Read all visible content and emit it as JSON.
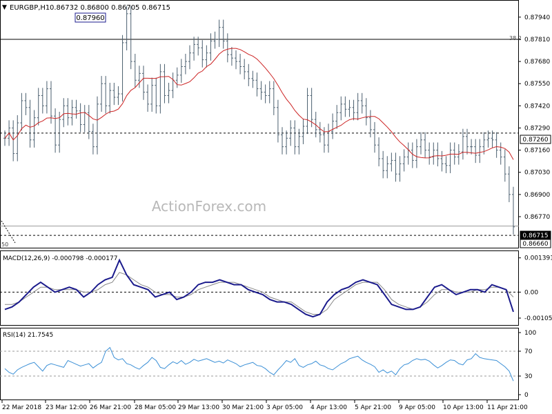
{
  "header": {
    "symbol": "EURGBP,H1",
    "ohlc": "0.86732 0.86800 0.86705 0.86715"
  },
  "watermark": "ActionForex.com",
  "colors": {
    "price": "#4a5e6e",
    "ma": "#cc2222",
    "macd": "#1a1a8c",
    "signal": "#888888",
    "rsi": "#3a8fd6",
    "grid": "#000000",
    "axis_text": "#000000"
  },
  "chart_data": [
    {
      "type": "line",
      "name": "price",
      "title": "EURGBP,H1",
      "series": [
        {
          "name": "",
          "values": [
            0.8723,
            0.8729,
            0.8714,
            0.8732,
            0.8745,
            0.8741,
            0.8722,
            0.8735,
            0.8748,
            0.8742,
            0.8752,
            0.8736,
            0.8719,
            0.8734,
            0.8742,
            0.8735,
            0.8741,
            0.8739,
            0.8731,
            0.8738,
            0.8727,
            0.8718,
            0.8743,
            0.8755,
            0.8742,
            0.8751,
            0.8747,
            0.8749,
            0.8779,
            0.8796,
            0.8768,
            0.8757,
            0.8761,
            0.875,
            0.8743,
            0.8754,
            0.8742,
            0.8762,
            0.8748,
            0.8751,
            0.8757,
            0.876,
            0.8765,
            0.8768,
            0.8773,
            0.8778,
            0.8776,
            0.8769,
            0.8773,
            0.878,
            0.8781,
            0.8788,
            0.878,
            0.8772,
            0.877,
            0.8768,
            0.8765,
            0.8762,
            0.8758,
            0.8757,
            0.8752,
            0.875,
            0.8748,
            0.8752,
            0.8741,
            0.8725,
            0.8718,
            0.8723,
            0.8729,
            0.8718,
            0.8724,
            0.873,
            0.8748,
            0.8734,
            0.8728,
            0.8725,
            0.8719,
            0.8727,
            0.8733,
            0.8738,
            0.8743,
            0.874,
            0.8741,
            0.8738,
            0.8745,
            0.8742,
            0.8735,
            0.8728,
            0.8719,
            0.8711,
            0.8704,
            0.8708,
            0.871,
            0.8702,
            0.8708,
            0.8712,
            0.8716,
            0.871,
            0.8718,
            0.8722,
            0.8716,
            0.8712,
            0.8716,
            0.8711,
            0.8708,
            0.8707,
            0.8716,
            0.8712,
            0.8715,
            0.8724,
            0.8718,
            0.8718,
            0.8713,
            0.8718,
            0.8722,
            0.8723,
            0.8722,
            0.8716,
            0.8712,
            0.8702,
            0.869,
            0.8671
          ]
        }
      ],
      "ylim": [
        0.866,
        0.88
      ],
      "y_ticks": [
        "0.87940",
        "0.87810",
        "0.87680",
        "0.87550",
        "0.87420",
        "0.87290",
        "0.87160",
        "0.87030",
        "0.86900",
        "0.86770"
      ],
      "x_ticks": [
        "22 Mar 2018",
        "23 Mar 12:00",
        "26 Mar 21:00",
        "28 Mar 05:00",
        "29 Mar 13:00",
        "30 Mar 21:00",
        "3 Apr 05:00",
        "4 Apr 13:00",
        "5 Apr 21:00",
        "9 Apr 05:00",
        "10 Apr 13:00",
        "11 Apr 21:00"
      ],
      "annotations": {
        "high_label": "0.87960",
        "fib_label": "38.2",
        "fib_level": 0.8781,
        "fib_low_label": "50",
        "support_level": 0.8726,
        "support_label": "0.87260",
        "last_label": "0.86715",
        "low_label": "0.86660"
      }
    },
    {
      "type": "line",
      "name": "macd",
      "title": "MACD(12,26,9) -0.000798 -0.000177",
      "ylim": [
        -0.00125,
        0.00155
      ],
      "y_ticks": [
        "0.001391",
        "0.00",
        "-0.001054"
      ],
      "series": [
        {
          "name": "",
          "values": [
            -0.0007,
            -0.0006,
            -0.0004,
            -0.0001,
            0.0002,
            0.0004,
            0.0002,
            0.0,
            0.0001,
            0.0002,
            0.0001,
            -0.0002,
            0.0,
            0.0003,
            0.0005,
            0.0006,
            0.0013,
            0.0007,
            0.0003,
            0.0002,
            0.0001,
            -0.0002,
            -0.0001,
            0.0,
            -0.0003,
            -0.0002,
            0.0,
            0.0003,
            0.0004,
            0.0004,
            0.0005,
            0.0004,
            0.0003,
            0.0003,
            0.0001,
            0.0,
            -0.0001,
            -0.0003,
            -0.0004,
            -0.0004,
            -0.0005,
            -0.0007,
            -0.0009,
            -0.001,
            -0.0009,
            -0.0004,
            -0.0001,
            0.0001,
            0.0002,
            0.0004,
            0.0005,
            0.0004,
            0.0003,
            -0.0001,
            -0.0005,
            -0.0006,
            -0.0007,
            -0.0007,
            -0.0006,
            -0.0002,
            0.0002,
            0.0003,
            0.0001,
            -0.0001,
            0.0,
            0.0001,
            0.0001,
            0.0,
            0.0003,
            0.0002,
            0.0001,
            -0.0008
          ]
        },
        {
          "name": "",
          "values": [
            -0.0005,
            -0.0005,
            -0.0004,
            -0.0002,
            0.0,
            0.0002,
            0.0002,
            0.0001,
            0.0001,
            0.0001,
            0.0001,
            0.0,
            0.0,
            0.0001,
            0.0003,
            0.0004,
            0.0008,
            0.0007,
            0.0005,
            0.0003,
            0.0002,
            0.0,
            -0.0001,
            -0.0001,
            -0.0002,
            -0.0002,
            -0.0001,
            0.0001,
            0.0002,
            0.0003,
            0.0004,
            0.0004,
            0.0004,
            0.0003,
            0.0002,
            0.0001,
            0.0,
            -0.0002,
            -0.0003,
            -0.0004,
            -0.0004,
            -0.0006,
            -0.0008,
            -0.0009,
            -0.0009,
            -0.0007,
            -0.0003,
            -0.0001,
            0.0001,
            0.0003,
            0.0004,
            0.0004,
            0.0004,
            0.0001,
            -0.0003,
            -0.0005,
            -0.0006,
            -0.0007,
            -0.0006,
            -0.0004,
            -0.0001,
            0.0001,
            0.0001,
            0.0,
            0.0,
            0.0,
            0.0001,
            0.0001,
            0.0002,
            0.0002,
            0.0001,
            -0.0002
          ]
        }
      ]
    },
    {
      "type": "line",
      "name": "rsi",
      "title": "RSI(14) 21.7545",
      "ylim": [
        0,
        100
      ],
      "y_ticks": [
        "100",
        "70",
        "30",
        "0"
      ],
      "levels": [
        70,
        30
      ],
      "series": [
        {
          "name": "",
          "values": [
            42,
            36,
            33,
            40,
            44,
            47,
            50,
            52,
            45,
            38,
            47,
            50,
            48,
            46,
            44,
            55,
            52,
            49,
            46,
            48,
            50,
            43,
            48,
            52,
            70,
            76,
            60,
            56,
            58,
            50,
            48,
            44,
            41,
            47,
            52,
            60,
            55,
            44,
            42,
            48,
            53,
            50,
            55,
            49,
            52,
            57,
            54,
            56,
            58,
            55,
            52,
            54,
            51,
            56,
            53,
            50,
            45,
            48,
            50,
            52,
            47,
            46,
            42,
            36,
            32,
            40,
            47,
            55,
            52,
            58,
            47,
            44,
            48,
            50,
            54,
            48,
            46,
            42,
            40,
            45,
            50,
            53,
            58,
            60,
            62,
            56,
            52,
            49,
            45,
            36,
            40,
            35,
            38,
            32,
            42,
            48,
            50,
            55,
            58,
            56,
            57,
            54,
            48,
            43,
            47,
            52,
            56,
            55,
            50,
            48,
            56,
            58,
            66,
            60,
            58,
            57,
            56,
            55,
            50,
            45,
            38,
            22
          ]
        }
      ]
    }
  ]
}
